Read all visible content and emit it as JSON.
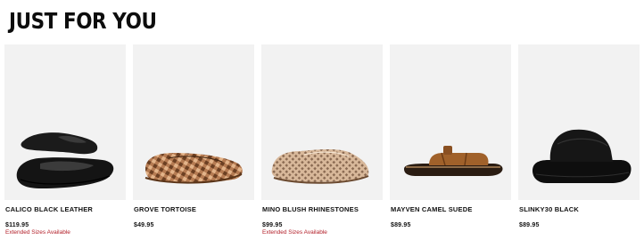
{
  "section": {
    "title": "JUST FOR YOU"
  },
  "products": [
    {
      "name": "CALICO BLACK LEATHER",
      "price": "$119.95",
      "badge": "Extended Sizes Available",
      "icon": "black-ballet-flat-icon"
    },
    {
      "name": "GROVE TORTOISE",
      "price": "$49.95",
      "badge": "",
      "icon": "woven-flat-icon"
    },
    {
      "name": "MINO BLUSH RHINESTONES",
      "price": "$99.95",
      "badge": "Extended Sizes Available",
      "icon": "mesh-flat-icon"
    },
    {
      "name": "MAYVEN CAMEL SUEDE",
      "price": "$89.95",
      "badge": "",
      "icon": "slide-sandal-icon"
    },
    {
      "name": "SLINKY30 BLACK",
      "price": "$89.95",
      "badge": "",
      "icon": "platform-slide-icon"
    }
  ],
  "colors": {
    "image_bg": "#f2f2f2",
    "badge_red": "#b3202a",
    "text": "#111111"
  }
}
